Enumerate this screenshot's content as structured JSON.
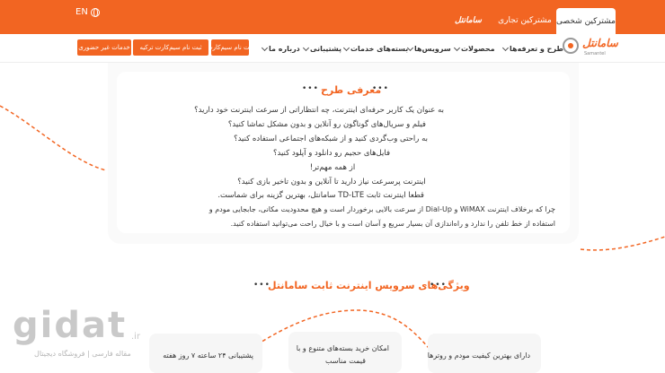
{
  "topbar": {
    "lang": "EN",
    "tabs": [
      {
        "label": "مشترکین شخصی",
        "active": true
      },
      {
        "label": "مشترکین تجاری",
        "active": false
      },
      {
        "label": "سامانتل",
        "active": false
      }
    ]
  },
  "nav": {
    "logo": "سامانتل",
    "logo_sub": "Samantel",
    "menu": [
      {
        "label": "طرح و تعرفه‌ها"
      },
      {
        "label": "محصولات"
      },
      {
        "label": "سرویس‌ها"
      },
      {
        "label": "بسته‌های خدمات"
      },
      {
        "label": "پشتیبانی"
      },
      {
        "label": "درباره ما"
      }
    ],
    "buttons": [
      {
        "label": "ثبت نام سیم‌کارت"
      },
      {
        "label": "ثبت نام سیم‌کارت ترکیه"
      },
      {
        "label": "خدمات غیر حضوری"
      }
    ]
  },
  "intro": {
    "title": "معرفی طرح",
    "dots": "•••",
    "lines": [
      "به عنوان یک کاربر حرفه‌ای اینترنت، چه انتظاراتی از سرعت اینترنت خود دارید؟",
      "فیلم و سریال‌های گوناگون رو آنلاین و بدون مشکل تماشا کنید؟",
      "به راحتی وب‌گردی کنید و از شبکه‌های اجتماعی استفاده کنید؟",
      "فایل‌های حجیم رو دانلود و آپلود کنید؟",
      "از همه مهم‌تر!",
      "اینترنت پرسرعت نیاز دارید تا آنلاین و بدون تاخیر بازی کنید؟",
      "قطعا اینترنت ثابت TD-LTE سامانتل، بهترین گزینه برای شماست.",
      "چرا که برخلاف اینترنت WiMAX و Dial-Up از سرعت بالایی برخوردار است و هیچ محدودیت مکانی، جابجایی مودم و",
      "استفاده از خط تلفن را ندارد و راه‌اندازی آن بسیار سریع و آسان است و با خیال راحت می‌توانید استفاده کنید."
    ]
  },
  "features": {
    "title": "ویژگی‌های سرویس اینترنت ثابت سامانتل",
    "dots": "•••",
    "cards": [
      {
        "text": "دارای بهترین کیفیت مودم و روترها"
      },
      {
        "line1": "امکان خرید بسته‌های متنوع و با",
        "line2": "قیمت مناسب"
      },
      {
        "text": "پشتیبانی ۲۴ ساعته ۷ روز هفته"
      }
    ]
  },
  "watermark": {
    "brand": "gidat",
    "tld": ".ir",
    "sub": "مقاله فارسی | فروشگاه دیجیتال"
  },
  "colors": {
    "accent": "#f26522"
  }
}
